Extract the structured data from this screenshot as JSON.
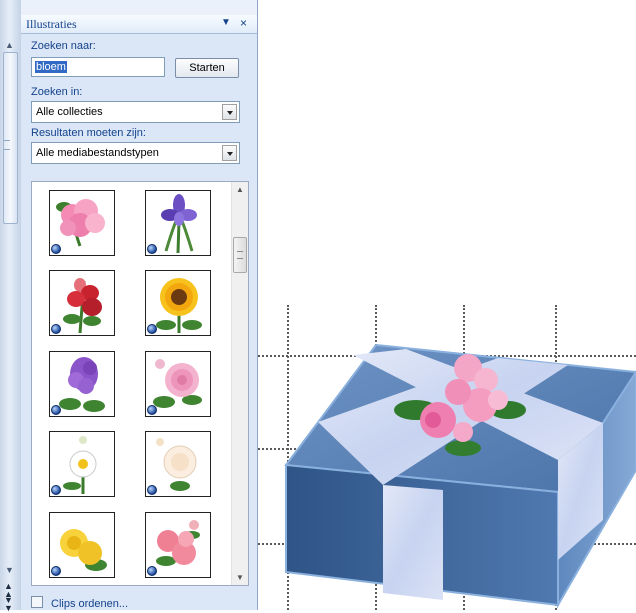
{
  "task_pane": {
    "title": "Illustraties",
    "search_label": "Zoeken naar:",
    "search_value": "bloem",
    "start_button": "Starten",
    "search_in_label": "Zoeken in:",
    "search_in_value": "Alle collecties",
    "results_label": "Resultaten moeten zijn:",
    "results_value": "Alle mediabestandstypen",
    "clips": [
      {
        "name": "pink-hydrangea"
      },
      {
        "name": "purple-iris"
      },
      {
        "name": "red-snapdragon"
      },
      {
        "name": "sunflower"
      },
      {
        "name": "purple-lilac"
      },
      {
        "name": "pink-dahlia"
      },
      {
        "name": "white-daisy"
      },
      {
        "name": "white-rose"
      },
      {
        "name": "yellow-rose"
      },
      {
        "name": "pink-carnation"
      }
    ],
    "organize_link": "Clips ordenen..."
  },
  "canvas": {
    "object": "blue gift box with pink flower bouquet",
    "colors": {
      "box_blue": "#5b84b8",
      "ribbon": "#c9d6f0",
      "flowers": "#f08ab8"
    }
  }
}
